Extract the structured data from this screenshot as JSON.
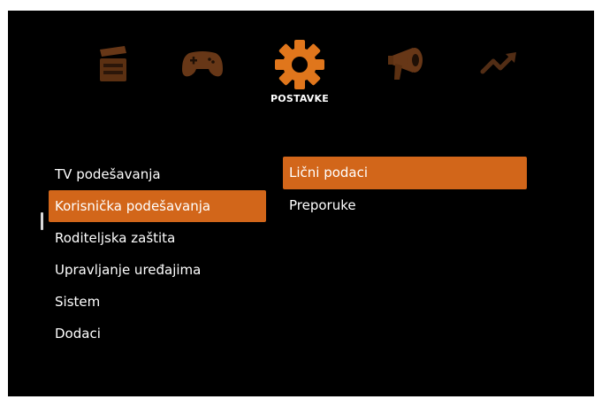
{
  "categories": [
    {
      "icon": "clapperboard-icon",
      "active": false
    },
    {
      "icon": "gamepad-icon",
      "active": false
    },
    {
      "icon": "gear-icon",
      "active": true,
      "label": "POSTAVKE"
    },
    {
      "icon": "megaphone-icon",
      "active": false
    },
    {
      "icon": "trend-arrow-icon",
      "active": false
    }
  ],
  "left_menu": {
    "items": [
      {
        "label": "TV podešavanja",
        "selected": false
      },
      {
        "label": "Korisnička podešavanja",
        "selected": true
      },
      {
        "label": "Roditeljska zaštita",
        "selected": false
      },
      {
        "label": "Upravljanje uređajima",
        "selected": false
      },
      {
        "label": "Sistem",
        "selected": false
      },
      {
        "label": "Dodaci",
        "selected": false
      }
    ]
  },
  "right_menu": {
    "items": [
      {
        "label": "Lični podaci",
        "selected": true
      },
      {
        "label": "Preporuke",
        "selected": false
      }
    ]
  },
  "colors": {
    "background": "#000000",
    "accent": "#d2661a",
    "icon_dim": "#6e3d1c",
    "icon_active": "#e0761c"
  }
}
